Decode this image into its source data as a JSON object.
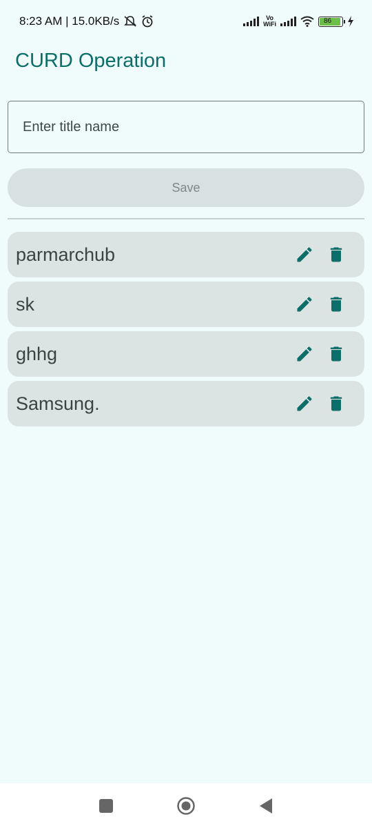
{
  "status_bar": {
    "time_info": "8:23 AM | 15.0KB/s",
    "vowifi": [
      "Vo",
      "WiFi"
    ],
    "battery_level": "86"
  },
  "app": {
    "title": "CURD Operation"
  },
  "form": {
    "title_placeholder": "Enter title name",
    "save_label": "Save"
  },
  "items": [
    {
      "label": "parmarchub"
    },
    {
      "label": "sk"
    },
    {
      "label": "ghhg"
    },
    {
      "label": "Samsung."
    }
  ],
  "colors": {
    "accent": "#0b6e69",
    "background": "#f0fbfb",
    "card": "#dbe4e3"
  },
  "icons": {
    "edit": "pencil-icon",
    "delete": "trash-icon",
    "nav_recents": "square-icon",
    "nav_home": "circle-icon",
    "nav_back": "triangle-back-icon"
  }
}
